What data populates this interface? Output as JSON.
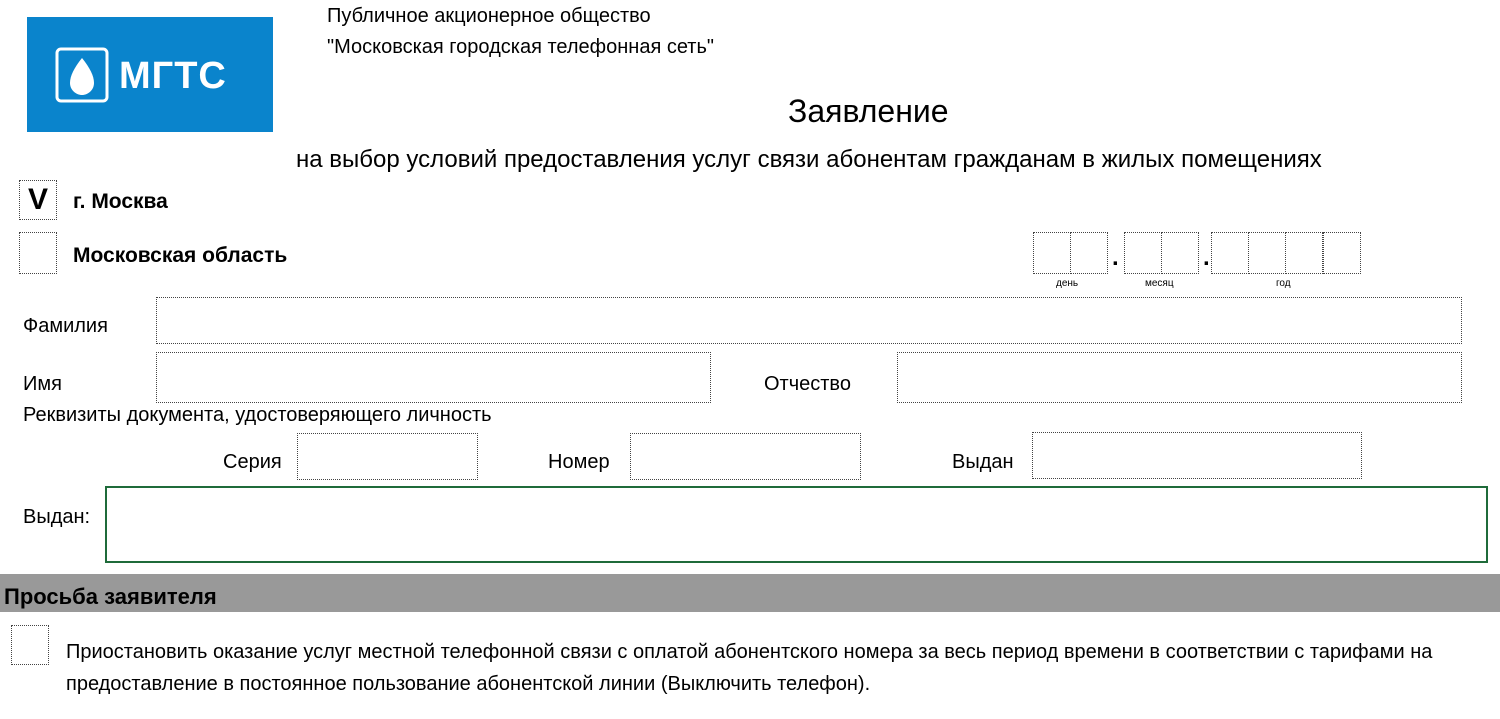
{
  "logo": {
    "text": "МГТС",
    "bg_color": "#0a84cc"
  },
  "header": {
    "org_line1": "Публичное акционерное общество",
    "org_line2": "\"Московская городская телефонная сеть\""
  },
  "title": "Заявление",
  "subtitle": "на выбор условий предоставления услуг связи абонентам гражданам в жилых помещениях",
  "region": {
    "moscow_mark": "V",
    "moscow_label": "г. Москва",
    "oblast_label": "Московская область"
  },
  "date": {
    "day_label": "день",
    "month_label": "месяц",
    "year_label": "год"
  },
  "person": {
    "surname_label": "Фамилия",
    "name_label": "Имя",
    "patronymic_label": "Отчество"
  },
  "document": {
    "heading": "Реквизиты документа, удостоверяющего личность",
    "series_label": "Серия",
    "number_label": "Номер",
    "issued_date_label": "Выдан",
    "issued_by_label": "Выдан:"
  },
  "request": {
    "section_title": "Просьба заявителя",
    "option1_text": "Приостановить оказание услуг местной телефонной связи с оплатой абонентского номера за весь период времени в соответствии с тарифами на предоставление в постоянное пользование абонентской линии (Выключить телефон)."
  },
  "colors": {
    "section_bar": "#999999",
    "active_border": "#1f6b3a"
  }
}
